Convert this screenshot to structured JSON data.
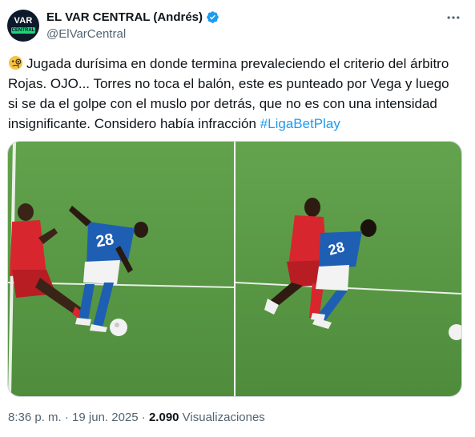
{
  "author": {
    "name": "EL VAR CENTRAL (Andrés)",
    "handle": "@ElVarCentral",
    "avatar_line1": "VAR",
    "avatar_line2": "CENTRAL",
    "verified": true
  },
  "tweet": {
    "text": "Jugada durísima en donde termina prevaleciendo el criterio del árbitro Rojas. OJO... Torres no toca el balón, este es punteado por Vega y luego si se da el golpe con el muslo por detrás, que no es con una intensidad insignificante. Considero había infracción ",
    "hashtag": "#LigaBetPlay",
    "emoji": "face-with-monocle-icon"
  },
  "media": {
    "images": [
      "soccer-photo-left",
      "soccer-photo-right"
    ]
  },
  "meta": {
    "time": "8:36 p. m.",
    "sep1": " · ",
    "date": "19 jun. 2025",
    "sep2": " · ",
    "views_count": "2.090",
    "views_label": " Visualizaciones"
  },
  "colors": {
    "accent": "#1d9bf0",
    "muted": "#536471",
    "pitch": "#5f9c4a"
  }
}
